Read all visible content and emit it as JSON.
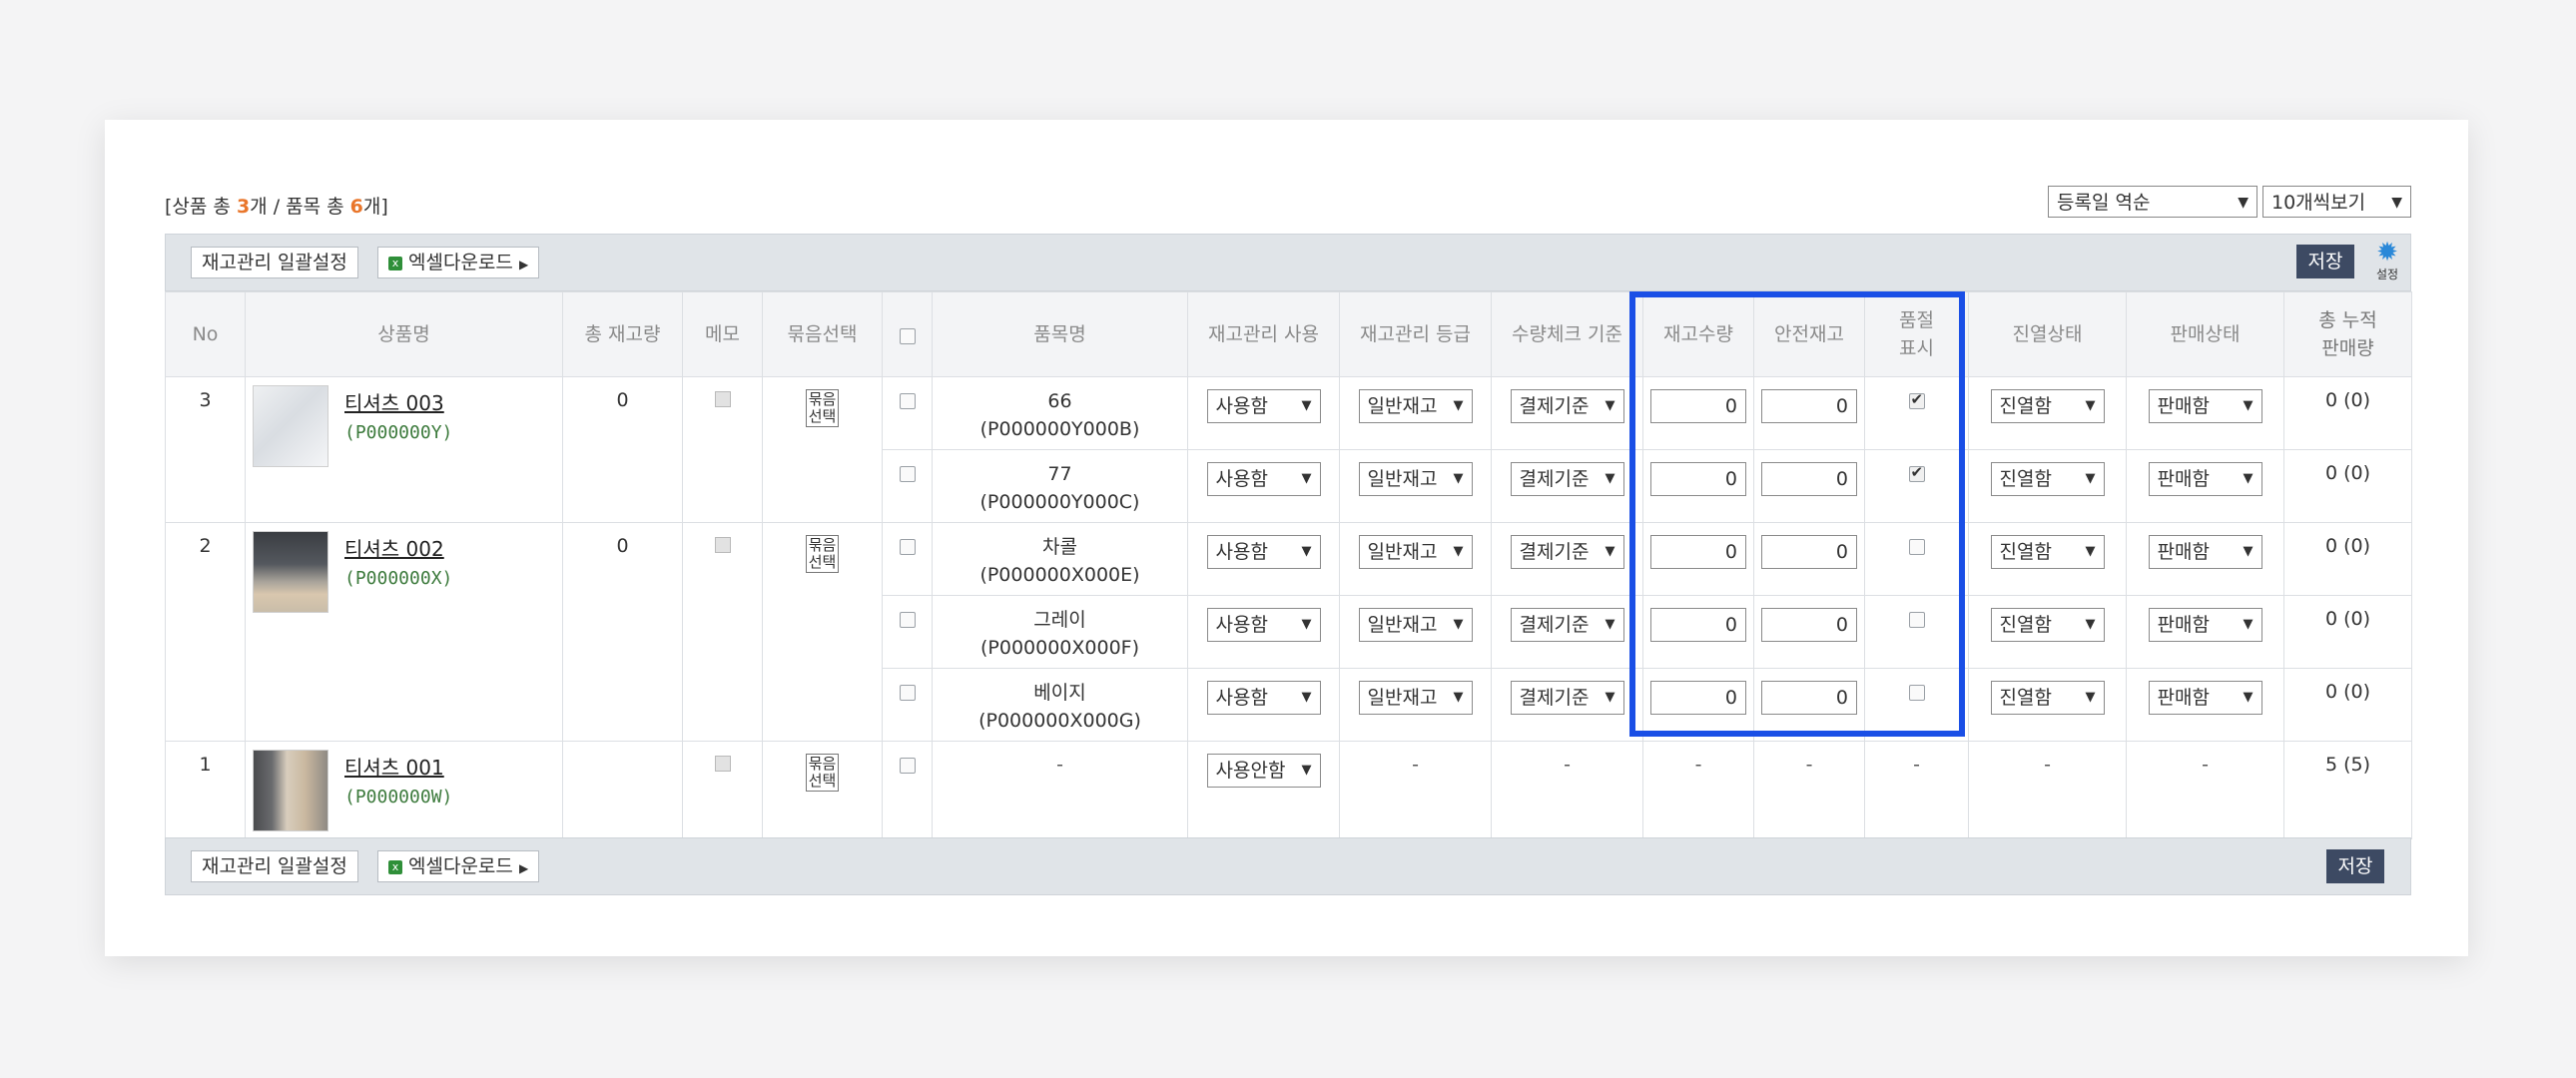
{
  "summary": {
    "prefix": "[상품 총 ",
    "product_count": "3",
    "mid": "개 / 품목 총 ",
    "item_count": "6",
    "suffix": "개]"
  },
  "sort_select": {
    "value": "등록일 역순"
  },
  "page_size_select": {
    "value": "10개씩보기"
  },
  "toolbar": {
    "bulk_label": "재고관리 일괄설정",
    "excel_label": "엑셀다운로드",
    "save_label": "저장",
    "settings_label": "설정"
  },
  "columns": {
    "no": "No",
    "product": "상품명",
    "total_stock": "총 재고량",
    "memo": "메모",
    "bundle": "묶음선택",
    "item": "품목명",
    "use": "재고관리 사용",
    "grade": "재고관리 등급",
    "check": "수량체크 기준",
    "qty": "재고수량",
    "safety": "안전재고",
    "soldout": "품절\n표시",
    "display": "진열상태",
    "sale": "판매상태",
    "cumulative": "총 누적\n판매량"
  },
  "products": [
    {
      "no": "3",
      "name": "티셔츠 003",
      "code": "(P000000Y)",
      "total_stock": "0",
      "bundle": "묶음\n선택"
    },
    {
      "no": "2",
      "name": "티셔츠 002",
      "code": "(P000000X)",
      "total_stock": "0",
      "bundle": "묶음\n선택"
    },
    {
      "no": "1",
      "name": "티셔츠 001",
      "code": "(P000000W)",
      "total_stock": "",
      "bundle": "묶음\n선택"
    }
  ],
  "items": [
    {
      "name": "66",
      "code": "(P000000Y000B)",
      "use": "사용함",
      "grade": "일반재고",
      "check": "결제기준",
      "qty": "0",
      "safety": "0",
      "soldout": true,
      "display": "진열함",
      "sale": "판매함",
      "cumulative": "0 (0)"
    },
    {
      "name": "77",
      "code": "(P000000Y000C)",
      "use": "사용함",
      "grade": "일반재고",
      "check": "결제기준",
      "qty": "0",
      "safety": "0",
      "soldout": true,
      "display": "진열함",
      "sale": "판매함",
      "cumulative": "0 (0)"
    },
    {
      "name": "차콜",
      "code": "(P000000X000E)",
      "use": "사용함",
      "grade": "일반재고",
      "check": "결제기준",
      "qty": "0",
      "safety": "0",
      "soldout": false,
      "display": "진열함",
      "sale": "판매함",
      "cumulative": "0 (0)"
    },
    {
      "name": "그레이",
      "code": "(P000000X000F)",
      "use": "사용함",
      "grade": "일반재고",
      "check": "결제기준",
      "qty": "0",
      "safety": "0",
      "soldout": false,
      "display": "진열함",
      "sale": "판매함",
      "cumulative": "0 (0)"
    },
    {
      "name": "베이지",
      "code": "(P000000X000G)",
      "use": "사용함",
      "grade": "일반재고",
      "check": "결제기준",
      "qty": "0",
      "safety": "0",
      "soldout": false,
      "display": "진열함",
      "sale": "판매함",
      "cumulative": "0 (0)"
    }
  ],
  "last_row": {
    "item": "-",
    "use": "사용안함",
    "grade": "-",
    "check": "-",
    "qty": "-",
    "safety": "-",
    "soldout": "-",
    "display": "-",
    "sale": "-",
    "cumulative": "5 (5)"
  },
  "colors": {
    "highlight": "#1a4fe6",
    "accent_count": "#e9762b",
    "save_button": "#3d4a63",
    "toolbar_bg": "#e0e4e8"
  }
}
